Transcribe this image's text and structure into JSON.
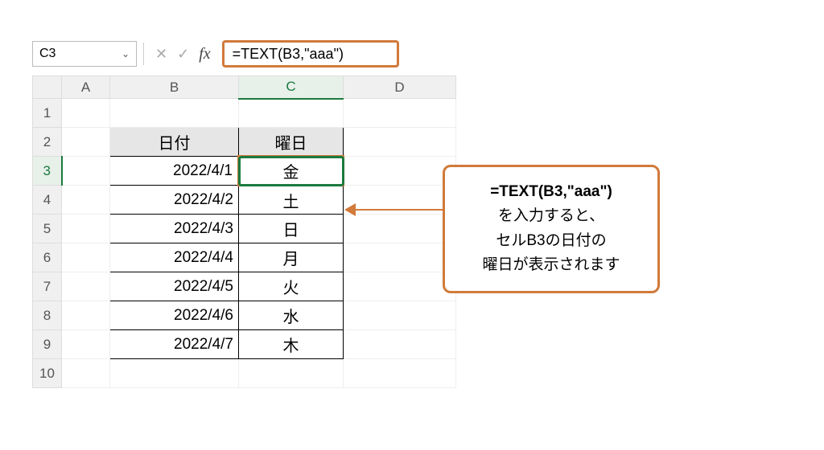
{
  "namebox": {
    "value": "C3"
  },
  "formula_bar": {
    "formula": "=TEXT(B3,\"aaa\")"
  },
  "columns": [
    "A",
    "B",
    "C",
    "D"
  ],
  "row_numbers": [
    1,
    2,
    3,
    4,
    5,
    6,
    7,
    8,
    9,
    10
  ],
  "selected_cell": "C3",
  "selected_row": 3,
  "selected_col": "C",
  "headers": {
    "b2": "日付",
    "c2": "曜日"
  },
  "rows": [
    {
      "date": "2022/4/1",
      "day": "金"
    },
    {
      "date": "2022/4/2",
      "day": "土"
    },
    {
      "date": "2022/4/3",
      "day": "日"
    },
    {
      "date": "2022/4/4",
      "day": "月"
    },
    {
      "date": "2022/4/5",
      "day": "火"
    },
    {
      "date": "2022/4/6",
      "day": "水"
    },
    {
      "date": "2022/4/7",
      "day": "木"
    }
  ],
  "callout": {
    "line1": "=TEXT(B3,\"aaa\")",
    "line2": "を入力すると、",
    "line3": "セルB3の日付の",
    "line4": "曜日が表示されます"
  },
  "icons": {
    "cancel": "✕",
    "confirm": "✓",
    "fx": "fx",
    "chevron": "⌄"
  }
}
